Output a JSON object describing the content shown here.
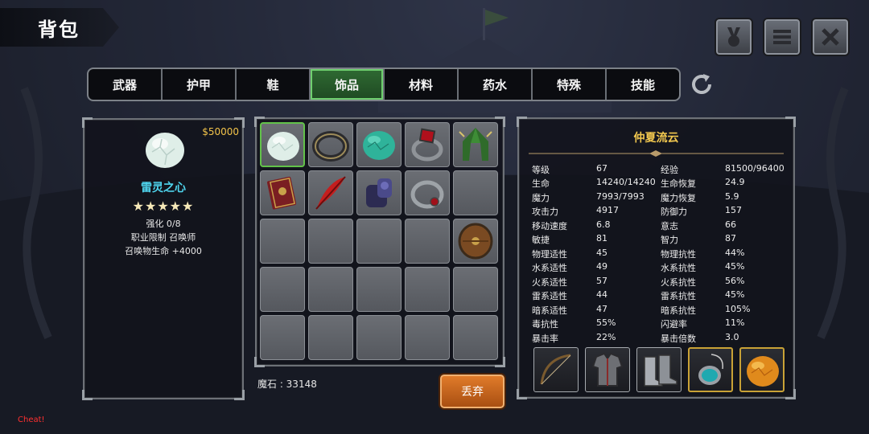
{
  "window": {
    "title": "背包"
  },
  "top_buttons": [
    {
      "icon": "medal-icon"
    },
    {
      "icon": "menu-icon"
    },
    {
      "icon": "close-icon"
    }
  ],
  "tabs": [
    "武器",
    "护甲",
    "鞋",
    "饰品",
    "材料",
    "药水",
    "特殊",
    "技能"
  ],
  "active_tab": "饰品",
  "selected_item": {
    "price": "$50000",
    "name": "雷灵之心",
    "stars": "★★★★★",
    "enhance": "强化 0/8",
    "job_limit": "职业限制  召唤师",
    "bonus": "召唤物生命  +4000",
    "icon": "white-stone-icon"
  },
  "inventory": [
    {
      "icon": "white-stone-icon",
      "selected": true
    },
    {
      "icon": "dark-ring-icon"
    },
    {
      "icon": "green-stone-icon"
    },
    {
      "icon": "ruby-ring-icon"
    },
    {
      "icon": "green-hood-icon"
    },
    {
      "icon": "tome-icon"
    },
    {
      "icon": "red-feather-icon"
    },
    {
      "icon": "purple-gauntlet-icon"
    },
    {
      "icon": "silver-ring-icon"
    },
    {
      "icon": ""
    },
    {
      "icon": ""
    },
    {
      "icon": ""
    },
    {
      "icon": ""
    },
    {
      "icon": ""
    },
    {
      "icon": "round-shield-icon"
    },
    {
      "icon": ""
    },
    {
      "icon": ""
    },
    {
      "icon": ""
    },
    {
      "icon": ""
    },
    {
      "icon": ""
    },
    {
      "icon": ""
    },
    {
      "icon": ""
    },
    {
      "icon": ""
    },
    {
      "icon": ""
    },
    {
      "icon": ""
    }
  ],
  "magic_stone": "魔石 : 33148",
  "discard_label": "丢弃",
  "character": {
    "name": "仲夏流云",
    "stats": [
      [
        "等级",
        "67",
        "经验",
        "81500/96400"
      ],
      [
        "生命",
        "14240/14240",
        "生命恢复",
        "24.9"
      ],
      [
        "魔力",
        "7993/7993",
        "魔力恢复",
        "5.9"
      ],
      [
        "攻击力",
        "4917",
        "防御力",
        "157"
      ],
      [
        "移动速度",
        "6.8",
        "意志",
        "66"
      ],
      [
        "敏捷",
        "81",
        "智力",
        "87"
      ],
      [
        "物理适性",
        "45",
        "物理抗性",
        "44%"
      ],
      [
        "水系适性",
        "49",
        "水系抗性",
        "45%"
      ],
      [
        "火系适性",
        "57",
        "火系抗性",
        "56%"
      ],
      [
        "雷系适性",
        "44",
        "雷系抗性",
        "45%"
      ],
      [
        "暗系适性",
        "47",
        "暗系抗性",
        "105%"
      ],
      [
        "毒抗性",
        "55%",
        "闪避率",
        "11%"
      ],
      [
        "暴击率",
        "22%",
        "暴击倍数",
        "3.0"
      ]
    ],
    "equipment": [
      {
        "icon": "bow-icon"
      },
      {
        "icon": "chest-armor-icon"
      },
      {
        "icon": "boots-icon"
      },
      {
        "icon": "teal-amulet-icon",
        "gold": true
      },
      {
        "icon": "amber-stone-icon",
        "gold": true
      }
    ]
  },
  "cheat_label": "Cheat!"
}
